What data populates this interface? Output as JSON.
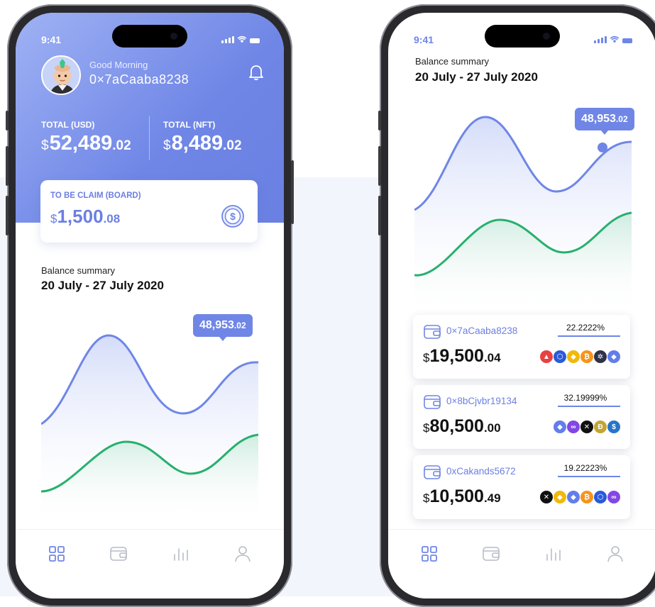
{
  "status": {
    "time": "9:41"
  },
  "phone1": {
    "greeting": "Good Morning",
    "address": "0×7aCaaba8238",
    "total_usd": {
      "label": "TOTAL (USD)",
      "currency": "$",
      "whole": "52,489",
      "decimal": ".02"
    },
    "total_nft": {
      "label": "TOTAL (NFT)",
      "currency": "$",
      "whole": "8,489",
      "decimal": ".02"
    },
    "claim": {
      "label": "TO BE CLAIM (BOARD)",
      "currency": "$",
      "whole": "1,500",
      "decimal": ".08"
    },
    "balance_summary": {
      "label": "Balance summary",
      "range": "20 July - 27 July 2020"
    },
    "tooltip": {
      "whole": "48,953",
      "decimal": ".02"
    }
  },
  "phone2": {
    "balance_summary": {
      "label": "Balance summary",
      "range": "20 July - 27 July 2020"
    },
    "tooltip": {
      "whole": "48,953",
      "decimal": ".02"
    },
    "wallets": [
      {
        "address": "0×7aCaaba8238",
        "percent": "22.2222%",
        "currency": "$",
        "whole": "19,500",
        "decimal": ".04",
        "tokens": [
          "avalanche-icon",
          "chainlink-icon",
          "bnb-icon",
          "bitcoin-icon",
          "cosmos-icon",
          "ethereum-icon"
        ]
      },
      {
        "address": "0×8bCjvbr19134",
        "percent": "32.19999%",
        "currency": "$",
        "whole": "80,500",
        "decimal": ".00",
        "tokens": [
          "ethereum-icon",
          "polygon-icon",
          "xrp-icon",
          "dogecoin-icon",
          "usdc-icon"
        ]
      },
      {
        "address": "0xCakands5672",
        "percent": "19.22223%",
        "currency": "$",
        "whole": "10,500",
        "decimal": ".49",
        "tokens": [
          "xrp-icon",
          "bnb-icon",
          "ethereum-icon",
          "bitcoin-icon",
          "chainlink-icon",
          "polygon-icon"
        ]
      }
    ]
  },
  "tabs": [
    "dashboard-icon",
    "wallet-icon",
    "stats-icon",
    "profile-icon"
  ],
  "colors": {
    "primary": "#6f86e6",
    "green": "#27b06e",
    "dark": "#111111"
  }
}
